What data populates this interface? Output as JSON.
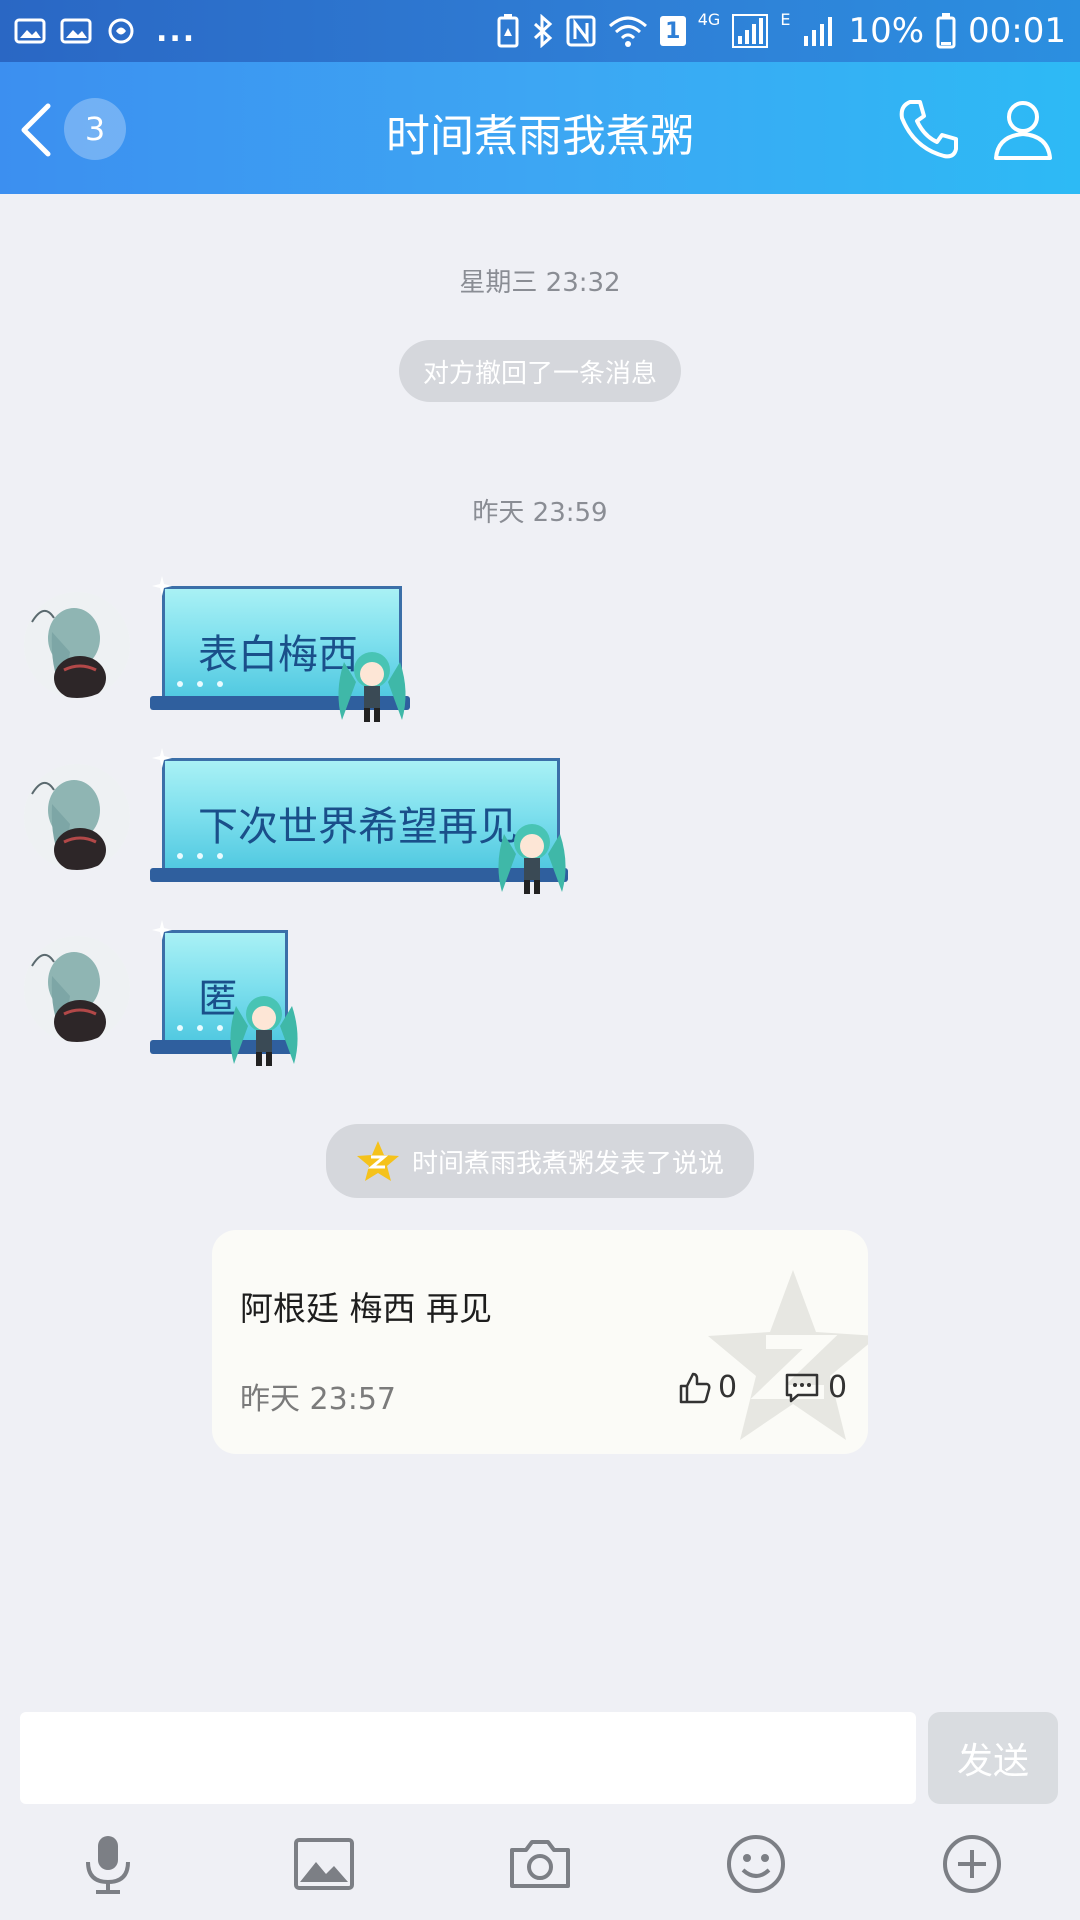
{
  "status_bar": {
    "battery_text": "10%",
    "time": "00:01",
    "network_4g": "4G",
    "network_e": "E",
    "sim_slot": "1",
    "ellipsis": "..."
  },
  "header": {
    "unread_count": "3",
    "title": "时间煮雨我煮粥"
  },
  "messages": {
    "timestamp_1": "星期三 23:32",
    "recall_notice": "对方撤回了一条消息",
    "timestamp_2": "昨天 23:59",
    "bubbles": [
      {
        "text": "表白梅西"
      },
      {
        "text": "下次世界希望再见"
      },
      {
        "text": "匿"
      }
    ],
    "post_notice": "时间煮雨我煮粥发表了说说"
  },
  "feed_card": {
    "text": "阿根廷 梅西 再见",
    "time": "昨天 23:57",
    "likes": "0",
    "comments": "0"
  },
  "composer": {
    "input_value": "",
    "send_label": "发送"
  },
  "toolbar": {
    "icons": [
      "microphone-icon",
      "image-icon",
      "camera-icon",
      "emoji-icon",
      "plus-icon"
    ]
  },
  "colors": {
    "header_start": "#3c8ff0",
    "header_end": "#2dbaf5",
    "background": "#eff0f5",
    "bubble_text": "#1a4f8a"
  }
}
